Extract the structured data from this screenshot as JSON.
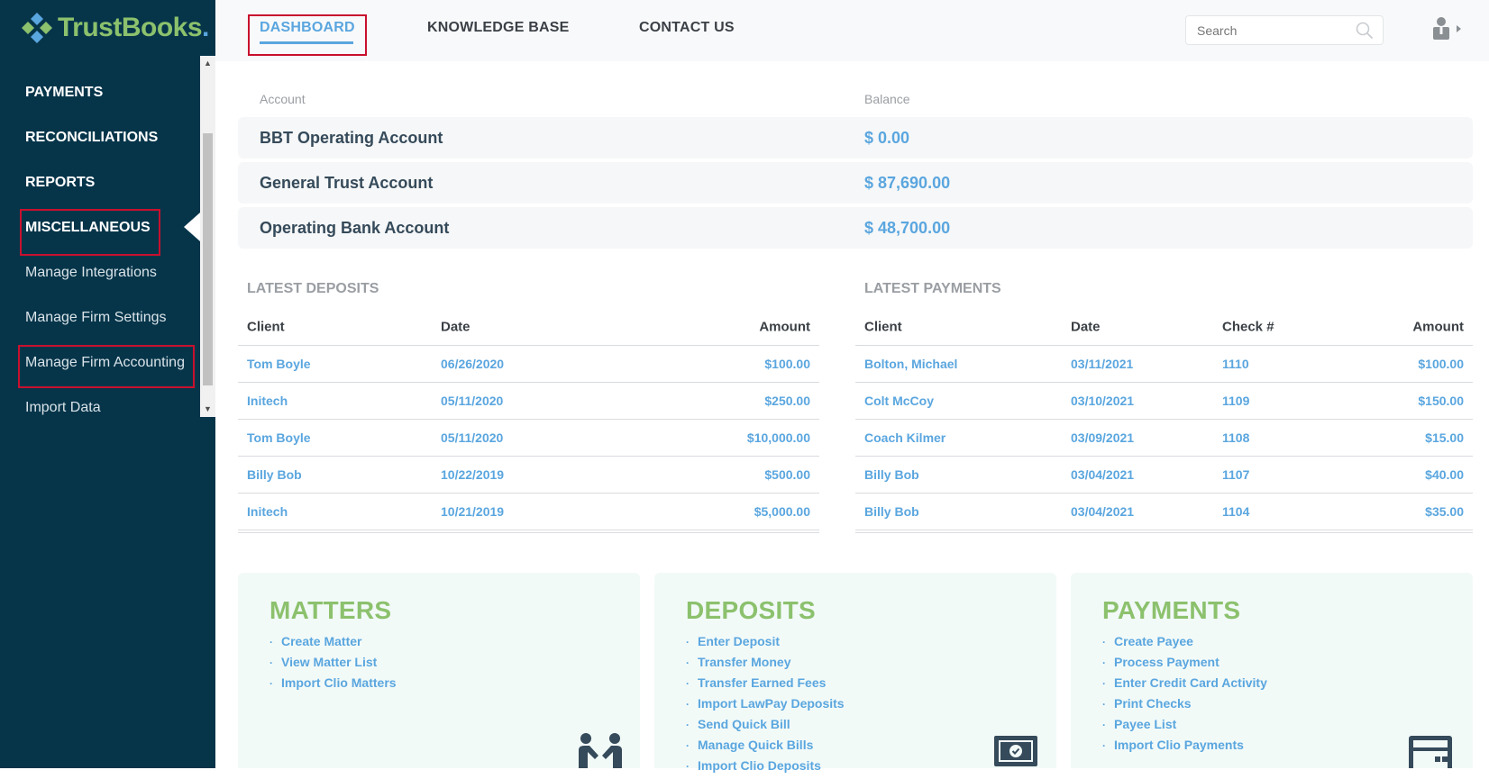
{
  "brand": {
    "name": "TrustBooks",
    "dot": "."
  },
  "sidebar": {
    "items": [
      {
        "label": "PAYMENTS",
        "bold": true
      },
      {
        "label": "RECONCILIATIONS",
        "bold": true
      },
      {
        "label": "REPORTS",
        "bold": true
      },
      {
        "label": "MISCELLANEOUS",
        "bold": true,
        "active": true
      },
      {
        "label": "Manage Integrations"
      },
      {
        "label": "Manage Firm Settings"
      },
      {
        "label": "Manage Firm Accounting"
      },
      {
        "label": "Import Data"
      }
    ]
  },
  "topnav": {
    "tabs": [
      {
        "label": "DASHBOARD",
        "active": true
      },
      {
        "label": "KNOWLEDGE BASE"
      },
      {
        "label": "CONTACT US"
      }
    ],
    "search_placeholder": "Search"
  },
  "accounts": {
    "col_account": "Account",
    "col_balance": "Balance",
    "rows": [
      {
        "name": "BBT Operating Account",
        "balance": "$ 0.00"
      },
      {
        "name": "General Trust Account",
        "balance": "$ 87,690.00"
      },
      {
        "name": "Operating Bank Account",
        "balance": "$ 48,700.00"
      }
    ]
  },
  "latest_deposits": {
    "title": "LATEST DEPOSITS",
    "headers": {
      "client": "Client",
      "date": "Date",
      "amount": "Amount"
    },
    "rows": [
      {
        "client": "Tom Boyle",
        "date": "06/26/2020",
        "amount": "$100.00"
      },
      {
        "client": "Initech",
        "date": "05/11/2020",
        "amount": "$250.00"
      },
      {
        "client": "Tom Boyle",
        "date": "05/11/2020",
        "amount": "$10,000.00"
      },
      {
        "client": "Billy Bob",
        "date": "10/22/2019",
        "amount": "$500.00"
      },
      {
        "client": "Initech",
        "date": "10/21/2019",
        "amount": "$5,000.00"
      }
    ]
  },
  "latest_payments": {
    "title": "LATEST PAYMENTS",
    "headers": {
      "client": "Client",
      "date": "Date",
      "check": "Check #",
      "amount": "Amount"
    },
    "rows": [
      {
        "client": "Bolton, Michael",
        "date": "03/11/2021",
        "check": "1110",
        "amount": "$100.00"
      },
      {
        "client": "Colt McCoy",
        "date": "03/10/2021",
        "check": "1109",
        "amount": "$150.00"
      },
      {
        "client": "Coach Kilmer",
        "date": "03/09/2021",
        "check": "1108",
        "amount": "$15.00"
      },
      {
        "client": "Billy Bob",
        "date": "03/04/2021",
        "check": "1107",
        "amount": "$40.00"
      },
      {
        "client": "Billy Bob",
        "date": "03/04/2021",
        "check": "1104",
        "amount": "$35.00"
      }
    ]
  },
  "cards": {
    "matters": {
      "title": "MATTERS",
      "links": [
        "Create Matter",
        "View Matter List",
        "Import Clio Matters"
      ],
      "icon": "handshake-icon"
    },
    "deposits": {
      "title": "DEPOSITS",
      "links": [
        "Enter Deposit",
        "Transfer Money",
        "Transfer Earned Fees",
        "Import LawPay Deposits",
        "Send Quick Bill",
        "Manage Quick Bills",
        "Import Clio Deposits"
      ],
      "icon": "money-icon"
    },
    "payments": {
      "title": "PAYMENTS",
      "links": [
        "Create Payee",
        "Process Payment",
        "Enter Credit Card Activity",
        "Print Checks",
        "Payee List",
        "Import Clio Payments"
      ],
      "icon": "calculator-icon"
    }
  },
  "colors": {
    "sidebar_bg": "#06354a",
    "accent_blue": "#5aa6df",
    "brand_green": "#8cc16d",
    "highlight_red": "#c8102e"
  }
}
